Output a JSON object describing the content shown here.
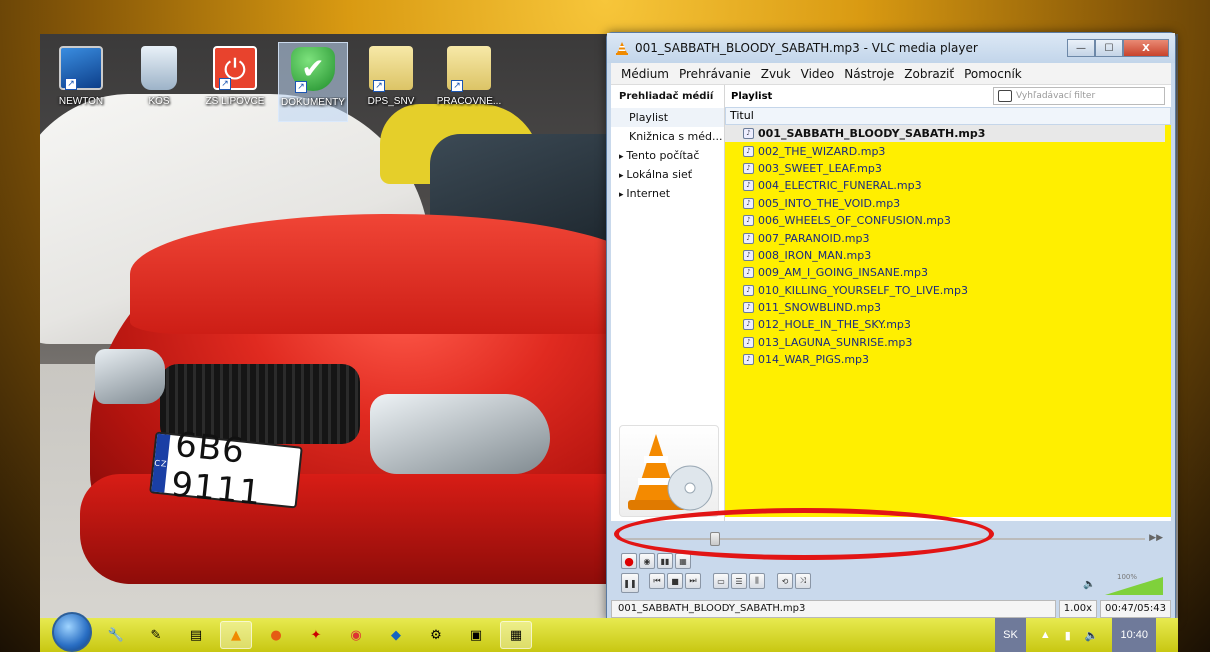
{
  "desktop": {
    "icons": [
      {
        "label": "NEWTON",
        "icon": "computer-icon"
      },
      {
        "label": "KÔŠ",
        "icon": "recycle-bin-icon"
      },
      {
        "label": "ZŠ LIPOVCE",
        "icon": "power-icon"
      },
      {
        "label": "DOKUMENTY",
        "icon": "shield-check-icon"
      },
      {
        "label": "DPS_SNV",
        "icon": "folder-icon"
      },
      {
        "label": "PRACOVNÉ...",
        "icon": "folder-icon"
      }
    ],
    "plate_text": "6B6 9111",
    "plate_country": "CZ"
  },
  "window": {
    "title": "001_SABBATH_BLOODY_SABATH.mp3 - VLC media player",
    "minimize": "—",
    "maximize": "☐",
    "close": "X"
  },
  "menu": [
    "Médium",
    "Prehrávanie",
    "Zvuk",
    "Video",
    "Nástroje",
    "Zobraziť",
    "Pomocník"
  ],
  "sidebar": {
    "header": "Prehliadač médií",
    "items": [
      "Playlist",
      "Knižnica s méd...",
      "Tento počítač",
      "Lokálna sieť",
      "Internet"
    ]
  },
  "playlist": {
    "header": "Playlist",
    "search_placeholder": "Vyhľadávací filter",
    "column": "Titul",
    "current_index": 0,
    "tracks": [
      "001_SABBATH_BLOODY_SABATH.mp3",
      "002_THE_WIZARD.mp3",
      "003_SWEET_LEAF.mp3",
      "004_ELECTRIC_FUNERAL.mp3",
      "005_INTO_THE_VOID.mp3",
      "006_WHEELS_OF_CONFUSION.mp3",
      "007_PARANOID.mp3",
      "008_IRON_MAN.mp3",
      "009_AM_I_GOING_INSANE.mp3",
      "010_KILLING_YOURSELF_TO_LIVE.mp3",
      "011_SNOWBLIND.mp3",
      "012_HOLE_IN_THE_SKY.mp3",
      "013_LAGUNA_SUNRISE.mp3",
      "014_WAR_PIGS.mp3"
    ],
    "highlight_color": "#ffef00"
  },
  "player": {
    "seek_fraction": 0.176,
    "volume_label": "100%",
    "status_file": "001_SABBATH_BLOODY_SABATH.mp3",
    "speed": "1.00x",
    "time": "00:47/05:43"
  },
  "taskbar": {
    "language": "SK",
    "clock": "10:40"
  },
  "annotation_color": "#e21515"
}
